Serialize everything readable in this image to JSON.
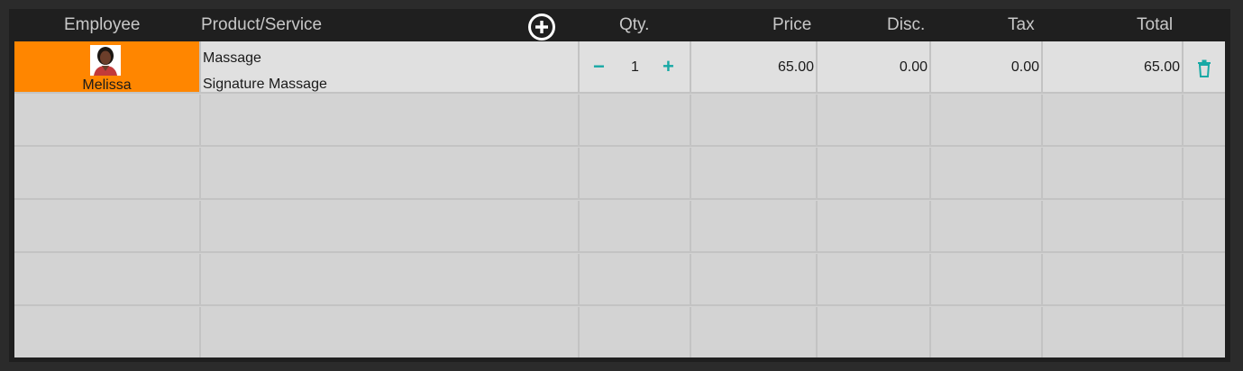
{
  "columns": {
    "employee": "Employee",
    "product": "Product/Service",
    "qty": "Qty.",
    "price": "Price",
    "disc": "Disc.",
    "tax": "Tax",
    "total": "Total"
  },
  "icons": {
    "add": "plus-circle-icon",
    "qty_decrease": "minus-icon",
    "qty_increase": "plus-icon",
    "delete": "trash-icon",
    "avatar": "employee-photo"
  },
  "colors": {
    "employee_highlight": "#ff8600",
    "accent": "#17a9a5"
  },
  "lines": [
    {
      "employee": "Melissa",
      "product": "Massage",
      "service": "Signature Massage",
      "qty": "1",
      "qty_minus": "−",
      "qty_plus": "+",
      "price": "65.00",
      "disc": "0.00",
      "tax": "0.00",
      "total": "65.00"
    }
  ]
}
